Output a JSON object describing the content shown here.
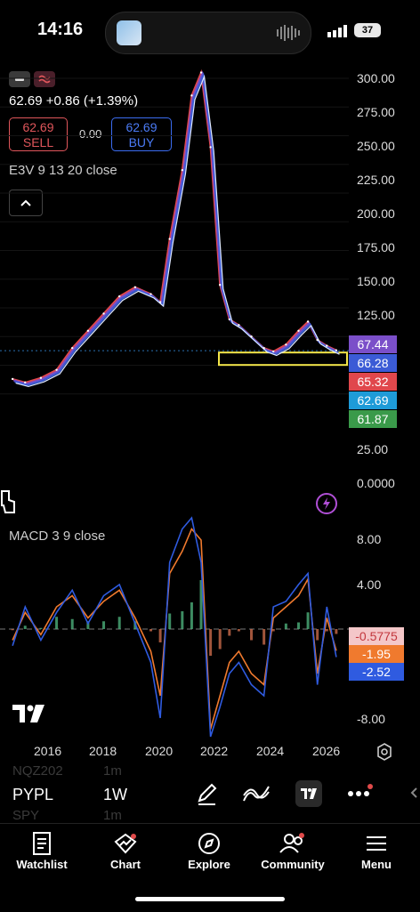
{
  "status": {
    "time": "14:16",
    "battery": "37"
  },
  "header": {
    "price_change": "62.69 +0.86 (+1.39%)",
    "sell_price": "62.69",
    "sell_label": "SELL",
    "spread": "0.00",
    "buy_price": "62.69",
    "buy_label": "BUY",
    "indicator": "E3V 9 13 20 close"
  },
  "price_axis": [
    "300.00",
    "275.00",
    "250.00",
    "225.00",
    "200.00",
    "175.00",
    "150.00",
    "125.00",
    "25.00",
    "0.0000"
  ],
  "price_tags": [
    {
      "value": "67.44",
      "color": "#7b4fc9"
    },
    {
      "value": "66.28",
      "color": "#3b5bd6"
    },
    {
      "value": "65.32",
      "color": "#e0474c"
    },
    {
      "value": "62.69",
      "color": "#1e9bd8"
    },
    {
      "value": "61.87",
      "color": "#3a9a4a"
    }
  ],
  "macd": {
    "label": "MACD 3 9 close",
    "axis": [
      "8.00",
      "4.00",
      "-8.00"
    ],
    "tags": [
      {
        "value": "-0.5775",
        "color": "#f4c7c9",
        "text_color": "#c2373d"
      },
      {
        "value": "-1.95",
        "color": "#f07a2e",
        "text_color": "#ffffff"
      },
      {
        "value": "-2.52",
        "color": "#2f5be0",
        "text_color": "#ffffff"
      }
    ]
  },
  "x_axis": [
    "2016",
    "2018",
    "2020",
    "2022",
    "2024",
    "2026"
  ],
  "toolbar": {
    "ticker": "PYPL",
    "interval": "1W",
    "ghost_1": "NQZ202",
    "ghost_1b": "1m",
    "ghost_2": "SPY",
    "ghost_2b": "1m"
  },
  "tabs": [
    {
      "label": "Watchlist",
      "icon": "watchlist-icon"
    },
    {
      "label": "Chart",
      "icon": "chart-icon"
    },
    {
      "label": "Explore",
      "icon": "compass-icon"
    },
    {
      "label": "Community",
      "icon": "community-icon"
    },
    {
      "label": "Menu",
      "icon": "menu-icon"
    }
  ],
  "chart_data": [
    {
      "type": "line",
      "title": "",
      "x": [
        2015.6,
        2016.0,
        2016.5,
        2017.0,
        2017.5,
        2018.0,
        2018.5,
        2019.0,
        2019.5,
        2020.0,
        2020.3,
        2020.6,
        2021.0,
        2021.3,
        2021.6,
        2021.9,
        2022.2,
        2022.5,
        2022.8,
        2023.2,
        2023.6,
        2023.9,
        2024.3,
        2024.7,
        2025.0,
        2025.3,
        2025.6,
        2025.9
      ],
      "y": [
        38,
        35,
        39,
        46,
        65,
        80,
        95,
        110,
        118,
        112,
        105,
        160,
        220,
        285,
        305,
        240,
        120,
        90,
        85,
        75,
        65,
        62,
        68,
        80,
        88,
        72,
        67,
        63
      ],
      "ylim": [
        0,
        310
      ],
      "xlim": [
        2015.2,
        2026.3
      ],
      "series_names": []
    },
    {
      "type": "line",
      "title": "",
      "x": [
        2015.6,
        2016.0,
        2016.5,
        2017.0,
        2017.5,
        2018.0,
        2018.5,
        2019.0,
        2019.5,
        2020.0,
        2020.3,
        2020.6,
        2021.0,
        2021.3,
        2021.6,
        2021.9,
        2022.2,
        2022.5,
        2022.8,
        2023.2,
        2023.6,
        2023.9,
        2024.3,
        2024.7,
        2025.0,
        2025.3,
        2025.6,
        2025.9
      ],
      "series": [
        {
          "values": [
            -1,
            1.5,
            -0.5,
            2,
            3,
            1,
            2.5,
            3.5,
            1,
            -2,
            -6,
            5,
            7,
            9,
            8,
            -9,
            -6,
            -3,
            -2,
            -4,
            -5,
            1,
            2,
            3,
            4.5,
            -4,
            1,
            -1.95
          ]
        },
        {
          "values": [
            -1.5,
            2,
            -1,
            1.5,
            3.5,
            0.5,
            3,
            4,
            0.5,
            -3,
            -8,
            6,
            9,
            11,
            6,
            -11,
            -7,
            -4,
            -3,
            -5,
            -6,
            2,
            2.5,
            4,
            5,
            -5,
            2,
            -2.52
          ]
        }
      ],
      "ylim": [
        -10,
        10
      ],
      "xlim": [
        2015.2,
        2026.3
      ]
    }
  ]
}
